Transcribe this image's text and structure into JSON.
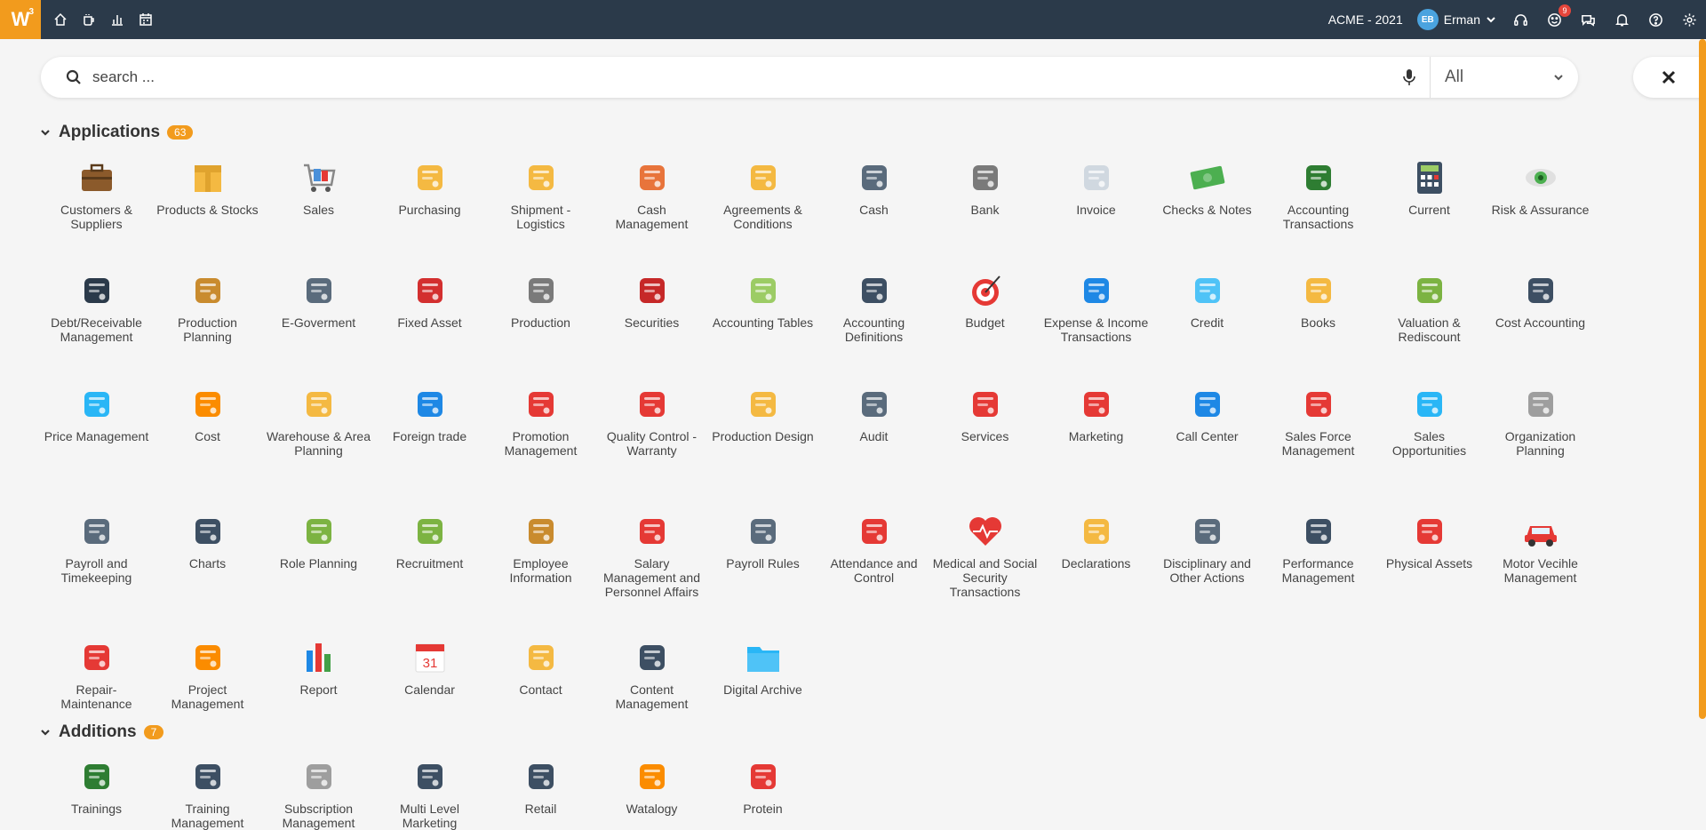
{
  "topbar": {
    "logo": "W",
    "logo_sup": "3",
    "nav": [
      "home-icon",
      "coffee-icon",
      "bar-chart-icon",
      "calendar-icon"
    ],
    "company": "ACME - 2021",
    "user_initials": "EB",
    "user_name": "Erman",
    "notification_count": "9",
    "colors": {
      "bar": "#2b3a4a",
      "accent": "#f29b1d",
      "badge": "#e5453b"
    }
  },
  "search": {
    "placeholder": "search ...",
    "filter_value": "All"
  },
  "applications": {
    "title": "Applications",
    "count": "63",
    "items": [
      {
        "label": "Customers & Suppliers",
        "icon": "briefcase-icon",
        "color": "#8b5a2b"
      },
      {
        "label": "Products & Stocks",
        "icon": "box-icon",
        "color": "#f4b942"
      },
      {
        "label": "Sales",
        "icon": "cart-icon",
        "color": "#4a90d9"
      },
      {
        "label": "Purchasing",
        "icon": "shopping-bag-icon",
        "color": "#f4b942"
      },
      {
        "label": "Shipment - Logistics",
        "icon": "truck-icon",
        "color": "#f4b942"
      },
      {
        "label": "Cash Management",
        "icon": "abacus-icon",
        "color": "#e8743b"
      },
      {
        "label": "Agreements & Conditions",
        "icon": "handshake-icon",
        "color": "#f4b942"
      },
      {
        "label": "Cash",
        "icon": "safe-icon",
        "color": "#5a6b7c"
      },
      {
        "label": "Bank",
        "icon": "bank-icon",
        "color": "#7a7a7a"
      },
      {
        "label": "Invoice",
        "icon": "invoice-icon",
        "color": "#d0d8e0"
      },
      {
        "label": "Checks & Notes",
        "icon": "money-icon",
        "color": "#4caf50"
      },
      {
        "label": "Accounting Transactions",
        "icon": "pen-icon",
        "color": "#2e7d32"
      },
      {
        "label": "Current",
        "icon": "calculator-icon",
        "color": "#3d4f63"
      },
      {
        "label": "Risk & Assurance",
        "icon": "eye-icon",
        "color": "#4caf50"
      },
      {
        "label": "Debt/Receivable Management",
        "icon": "line-chart-icon",
        "color": "#2b3a4a"
      },
      {
        "label": "Production Planning",
        "icon": "hourglass-icon",
        "color": "#c98b2e"
      },
      {
        "label": "E-Goverment",
        "icon": "government-icon",
        "color": "#5a6b7c"
      },
      {
        "label": "Fixed Asset",
        "icon": "faucet-icon",
        "color": "#d32f2f"
      },
      {
        "label": "Production",
        "icon": "factory-icon",
        "color": "#7a7a7a"
      },
      {
        "label": "Securities",
        "icon": "grapes-icon",
        "color": "#c62828"
      },
      {
        "label": "Accounting Tables",
        "icon": "spreadsheet-icon",
        "color": "#9ccc65"
      },
      {
        "label": "Accounting Definitions",
        "icon": "clipboard-icon",
        "color": "#3d4f63"
      },
      {
        "label": "Budget",
        "icon": "target-icon",
        "color": "#e53935"
      },
      {
        "label": "Expense & Income Transactions",
        "icon": "ruler-icon",
        "color": "#1e88e5"
      },
      {
        "label": "Credit",
        "icon": "beaker-icon",
        "color": "#4fc3f7"
      },
      {
        "label": "Books",
        "icon": "notebook-icon",
        "color": "#f4b942"
      },
      {
        "label": "Valuation & Rediscount",
        "icon": "tape-measure-icon",
        "color": "#7cb342"
      },
      {
        "label": "Cost Accounting",
        "icon": "pie-icon",
        "color": "#3d4f63"
      },
      {
        "label": "Price Management",
        "icon": "price-tag-icon",
        "color": "#29b6f6"
      },
      {
        "label": "Cost",
        "icon": "orange-icon",
        "color": "#fb8c00"
      },
      {
        "label": "Warehouse & Area Planning",
        "icon": "pallet-icon",
        "color": "#f4b942"
      },
      {
        "label": "Foreign trade",
        "icon": "ship-icon",
        "color": "#1e88e5"
      },
      {
        "label": "Promotion Management",
        "icon": "gift-icon",
        "color": "#e53935"
      },
      {
        "label": "Quality Control - Warranty",
        "icon": "flask-icon",
        "color": "#e53935"
      },
      {
        "label": "Production Design",
        "icon": "palette-icon",
        "color": "#f4b942"
      },
      {
        "label": "Audit",
        "icon": "glasses-icon",
        "color": "#5a6b7c"
      },
      {
        "label": "Services",
        "icon": "lifebuoy-icon",
        "color": "#e53935"
      },
      {
        "label": "Marketing",
        "icon": "megaphone-icon",
        "color": "#e53935"
      },
      {
        "label": "Call Center",
        "icon": "phone-24-icon",
        "color": "#1e88e5"
      },
      {
        "label": "Sales Force Management",
        "icon": "mountain-flag-icon",
        "color": "#e53935"
      },
      {
        "label": "Sales Opportunities",
        "icon": "shark-icon",
        "color": "#29b6f6"
      },
      {
        "label": "Organization Planning",
        "icon": "person-badge-icon",
        "color": "#9e9e9e"
      },
      {
        "label": "Payroll and Timekeeping",
        "icon": "time-card-icon",
        "color": "#5a6b7c"
      },
      {
        "label": "Charts",
        "icon": "org-chart-icon",
        "color": "#3d4f63"
      },
      {
        "label": "Role Planning",
        "icon": "chair-icon",
        "color": "#7cb342"
      },
      {
        "label": "Recruitment",
        "icon": "cactus-icon",
        "color": "#7cb342"
      },
      {
        "label": "Employee Information",
        "icon": "people-icon",
        "color": "#c98b2e"
      },
      {
        "label": "Salary Management and Personnel Affairs",
        "icon": "suitcase-icon",
        "color": "#e53935"
      },
      {
        "label": "Payroll Rules",
        "icon": "inbox-icon",
        "color": "#5a6b7c"
      },
      {
        "label": "Attendance and Control",
        "icon": "calendar-grid-icon",
        "color": "#e53935"
      },
      {
        "label": "Medical and Social Security Transactions",
        "icon": "heart-pulse-icon",
        "color": "#e53935"
      },
      {
        "label": "Declarations",
        "icon": "certificate-icon",
        "color": "#f4b942"
      },
      {
        "label": "Disciplinary and Other Actions",
        "icon": "scales-icon",
        "color": "#5a6b7c"
      },
      {
        "label": "Performance Management",
        "icon": "compass-icon",
        "color": "#3d4f63"
      },
      {
        "label": "Physical Assets",
        "icon": "plug-icon",
        "color": "#e53935"
      },
      {
        "label": "Motor Vecihle Management",
        "icon": "car-icon",
        "color": "#e53935"
      },
      {
        "label": "Repair-Maintenance",
        "icon": "tools-icon",
        "color": "#e53935"
      },
      {
        "label": "Project Management",
        "icon": "network-icon",
        "color": "#fb8c00"
      },
      {
        "label": "Report",
        "icon": "bars-icon",
        "color": "#1e88e5"
      },
      {
        "label": "Calendar",
        "icon": "calendar-31-icon",
        "color": "#e53935"
      },
      {
        "label": "Contact",
        "icon": "chat-bubbles-icon",
        "color": "#f4b942"
      },
      {
        "label": "Content Management",
        "icon": "presentation-icon",
        "color": "#3d4f63"
      },
      {
        "label": "Digital Archive",
        "icon": "folder-icon",
        "color": "#29b6f6"
      }
    ]
  },
  "additions": {
    "title": "Additions",
    "count": "7",
    "items": [
      {
        "label": "Trainings",
        "icon": "chalkboard-icon",
        "color": "#2e7d32"
      },
      {
        "label": "Training Management",
        "icon": "graduate-icon",
        "color": "#3d4f63"
      },
      {
        "label": "Subscription Management",
        "icon": "socket-icon",
        "color": "#9e9e9e"
      },
      {
        "label": "Multi Level Marketing",
        "icon": "hierarchy-icon",
        "color": "#3d4f63"
      },
      {
        "label": "Retail",
        "icon": "barcode-icon",
        "color": "#3d4f63"
      },
      {
        "label": "Watalogy",
        "icon": "laptop-bag-icon",
        "color": "#fb8c00"
      },
      {
        "label": "Protein",
        "icon": "shop-icon",
        "color": "#e53935"
      }
    ]
  }
}
